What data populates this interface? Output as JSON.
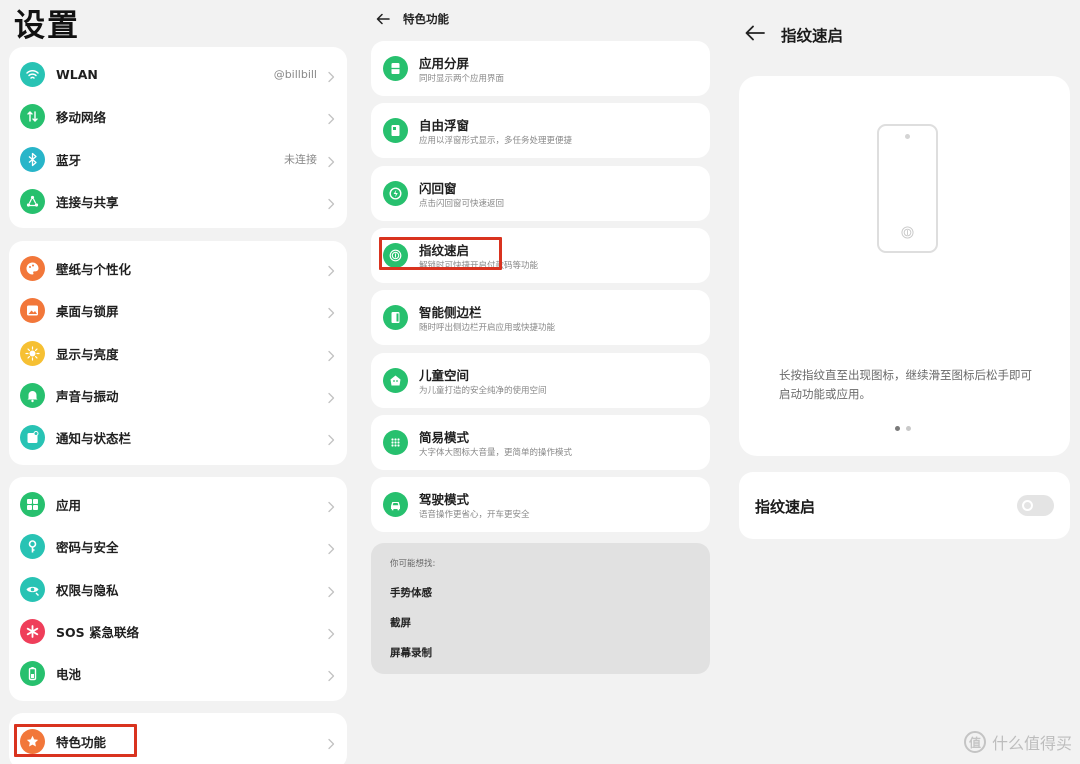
{
  "settings": {
    "title": "设置",
    "groups": [
      {
        "items": [
          {
            "label": "WLAN",
            "value": "@billbill",
            "icon": "wifi-icon",
            "color": "#28c3b4"
          },
          {
            "label": "移动网络",
            "value": "",
            "icon": "mobile-data-icon",
            "color": "#27c06e"
          },
          {
            "label": "蓝牙",
            "value": "未连接",
            "icon": "bluetooth-icon",
            "color": "#28b5c9"
          },
          {
            "label": "连接与共享",
            "value": "",
            "icon": "share-icon",
            "color": "#27c06e"
          }
        ]
      },
      {
        "items": [
          {
            "label": "壁纸与个性化",
            "value": "",
            "icon": "palette-icon",
            "color": "#f2773a"
          },
          {
            "label": "桌面与锁屏",
            "value": "",
            "icon": "image-icon",
            "color": "#f2773a"
          },
          {
            "label": "显示与亮度",
            "value": "",
            "icon": "sun-icon",
            "color": "#f6c033"
          },
          {
            "label": "声音与振动",
            "value": "",
            "icon": "bell-icon",
            "color": "#27c06e"
          },
          {
            "label": "通知与状态栏",
            "value": "",
            "icon": "notification-icon",
            "color": "#28c3b4"
          }
        ]
      },
      {
        "items": [
          {
            "label": "应用",
            "value": "",
            "icon": "apps-icon",
            "color": "#27c06e"
          },
          {
            "label": "密码与安全",
            "value": "",
            "icon": "key-icon",
            "color": "#28c3b4"
          },
          {
            "label": "权限与隐私",
            "value": "",
            "icon": "privacy-eye-icon",
            "color": "#28c3b4"
          },
          {
            "label": "SOS 紧急联络",
            "value": "",
            "icon": "sos-asterisk-icon",
            "color": "#ef3e5a"
          },
          {
            "label": "电池",
            "value": "",
            "icon": "battery-icon",
            "color": "#27c06e"
          }
        ]
      },
      {
        "items": [
          {
            "label": "特色功能",
            "value": "",
            "icon": "star-icon",
            "color": "#f2773a"
          }
        ]
      }
    ]
  },
  "features": {
    "title": "特色功能",
    "items": [
      {
        "title": "应用分屏",
        "subtitle": "同时显示两个应用界面",
        "icon": "split-screen-icon"
      },
      {
        "title": "自由浮窗",
        "subtitle": "应用以浮窗形式显示，多任务处理更便捷",
        "icon": "floating-window-icon"
      },
      {
        "title": "闪回窗",
        "subtitle": "点击闪回窗可快速返回",
        "icon": "flashback-icon"
      },
      {
        "title": "指纹速启",
        "subtitle": "解锁时可快捷开启付款码等功能",
        "icon": "fingerprint-icon"
      },
      {
        "title": "智能侧边栏",
        "subtitle": "随时呼出侧边栏开启应用或快捷功能",
        "icon": "sidebar-icon"
      },
      {
        "title": "儿童空间",
        "subtitle": "为儿童打造的安全纯净的使用空间",
        "icon": "kids-icon"
      },
      {
        "title": "简易模式",
        "subtitle": "大字体大图标大音量，更简单的操作模式",
        "icon": "simple-mode-icon"
      },
      {
        "title": "驾驶模式",
        "subtitle": "语音操作更省心，开车更安全",
        "icon": "car-icon"
      }
    ],
    "accent": "#27c06e",
    "suggestions": {
      "heading": "你可能想找:",
      "items": [
        "手势体感",
        "截屏",
        "屏幕录制"
      ]
    }
  },
  "detail": {
    "title": "指纹速启",
    "description": "长按指纹直至出现图标，继续滑至图标后松手即可启动功能或应用。",
    "pager": {
      "count": 2,
      "active": 0
    },
    "toggle": {
      "label": "指纹速启",
      "on": false
    }
  },
  "highlight_color": "#d9331f",
  "watermark": "什么值得买",
  "watermark_glyph": "值"
}
